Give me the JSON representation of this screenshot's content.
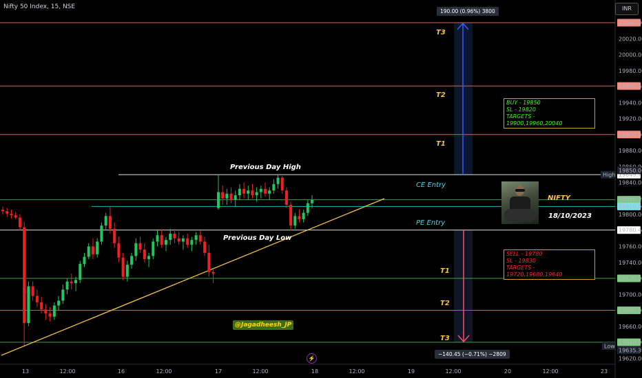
{
  "header": {
    "symbol": "Nifty 50 Index, 15, NSE",
    "currency": "INR"
  },
  "chart_data": {
    "type": "candlestick",
    "title": "Nifty 50 Index, 15, NSE",
    "ylim": [
      19620,
      20055
    ],
    "y_ticks": [
      19620,
      19640,
      19660,
      19680,
      19700,
      19720,
      19740,
      19760,
      19780,
      19800,
      19820,
      19840,
      19860,
      19880,
      19900,
      19920,
      19940,
      19960,
      19980,
      20000,
      20020,
      20040
    ],
    "x_ticks": [
      "13",
      "12:00",
      "16",
      "12:00",
      "17",
      "12:00",
      "18",
      "12:00",
      "19",
      "12:00",
      "20",
      "12:00",
      "23"
    ],
    "h_levels": [
      {
        "value": 20040.0,
        "label": "20040.00",
        "color": "#e57373",
        "bg": "#f28b82"
      },
      {
        "value": 19960.75,
        "label": "19960.75",
        "color": "#e57373",
        "bg": "#f28b82"
      },
      {
        "value": 19900.0,
        "label": "19900.00",
        "color": "#e57373",
        "bg": "#f28b82"
      },
      {
        "value": 19849.75,
        "label": "19849.75",
        "color": "#ffffff",
        "bg": "#ffffff"
      },
      {
        "value": 19818.35,
        "label": "19818.35",
        "color": "#4caf50",
        "bg": "#81c784"
      },
      {
        "value": 19810.0,
        "label": "19810.00",
        "color": "#26c6da",
        "bg": "#80deea"
      },
      {
        "value": 19780.45,
        "label": "19780.45",
        "color": "#ffffff",
        "bg": "#ffffff"
      },
      {
        "value": 19720.0,
        "label": "19720.00",
        "color": "#4caf50",
        "bg": "#81c784"
      },
      {
        "value": 19680.0,
        "label": "19680.00",
        "color": "#4caf50",
        "bg": "#81c784"
      },
      {
        "value": 19640.0,
        "label": "19640.00",
        "color": "#4caf50",
        "bg": "#81c784"
      }
    ],
    "extra_labels": [
      {
        "text": "19850.00",
        "value": 19850.0
      },
      {
        "text": "19635.30",
        "value": 19635.3
      }
    ],
    "hl_tags": {
      "high": "High",
      "low": "Low"
    },
    "annotations": {
      "prev_high": "Previous Day High",
      "prev_low": "Previous Day Low",
      "ce_entry": "CE Entry",
      "pe_entry": "PE Entry",
      "upper_targets": [
        "T3",
        "T2",
        "T1"
      ],
      "lower_targets": [
        "T1",
        "T2",
        "T3"
      ],
      "up_measure": "190.00 (0.96%) 3800",
      "down_measure": "−140.45 (−0.71%) −2809",
      "nifty": "NIFTY",
      "date": "18/10/2023",
      "watermark": "@Jagadheesh_JP"
    },
    "buy_box": [
      "BUY - 19850",
      "SL - 19820",
      "TARGETS - 19900,19960,20040"
    ],
    "sell_box": [
      "SELL - 19780",
      "SL - 19830",
      "TARGETS - 19720,19680,19640"
    ],
    "candles": [
      [
        19806,
        19810,
        19800,
        19804
      ],
      [
        19804,
        19808,
        19797,
        19801
      ],
      [
        19801,
        19806,
        19795,
        19799
      ],
      [
        19799,
        19803,
        19794,
        19796
      ],
      [
        19796,
        19800,
        19780,
        19784
      ],
      [
        19784,
        19791,
        19636,
        19664
      ],
      [
        19664,
        19716,
        19660,
        19710
      ],
      [
        19710,
        19716,
        19692,
        19698
      ],
      [
        19698,
        19706,
        19684,
        19690
      ],
      [
        19690,
        19697,
        19676,
        19681
      ],
      [
        19681,
        19688,
        19668,
        19676
      ],
      [
        19676,
        19684,
        19666,
        19672
      ],
      [
        19672,
        19690,
        19668,
        19686
      ],
      [
        19686,
        19698,
        19680,
        19692
      ],
      [
        19692,
        19712,
        19688,
        19706
      ],
      [
        19706,
        19720,
        19700,
        19716
      ],
      [
        19716,
        19726,
        19706,
        19714
      ],
      [
        19714,
        19722,
        19704,
        19718
      ],
      [
        19718,
        19742,
        19714,
        19738
      ],
      [
        19738,
        19752,
        19734,
        19747
      ],
      [
        19747,
        19764,
        19744,
        19760
      ],
      [
        19760,
        19770,
        19744,
        19750
      ],
      [
        19750,
        19770,
        19746,
        19766
      ],
      [
        19766,
        19790,
        19762,
        19786
      ],
      [
        19786,
        19802,
        19780,
        19798
      ],
      [
        19798,
        19810,
        19776,
        19782
      ],
      [
        19782,
        19790,
        19758,
        19764
      ],
      [
        19764,
        19772,
        19740,
        19746
      ],
      [
        19746,
        19752,
        19718,
        19722
      ],
      [
        19722,
        19742,
        19716,
        19737
      ],
      [
        19737,
        19752,
        19732,
        19748
      ],
      [
        19748,
        19770,
        19742,
        19764
      ],
      [
        19764,
        19772,
        19752,
        19756
      ],
      [
        19756,
        19764,
        19740,
        19744
      ],
      [
        19744,
        19752,
        19734,
        19748
      ],
      [
        19748,
        19770,
        19744,
        19766
      ],
      [
        19766,
        19780,
        19760,
        19774
      ],
      [
        19774,
        19782,
        19758,
        19762
      ],
      [
        19762,
        19772,
        19754,
        19768
      ],
      [
        19768,
        19782,
        19762,
        19776
      ],
      [
        19776,
        19782,
        19764,
        19770
      ],
      [
        19770,
        19778,
        19762,
        19766
      ],
      [
        19766,
        19774,
        19756,
        19770
      ],
      [
        19770,
        19776,
        19758,
        19762
      ],
      [
        19762,
        19772,
        19754,
        19768
      ],
      [
        19768,
        19778,
        19762,
        19774
      ],
      [
        19774,
        19780,
        19762,
        19766
      ],
      [
        19766,
        19772,
        19748,
        19752
      ],
      [
        19752,
        19762,
        19722,
        19728
      ],
      [
        19728,
        19732,
        19714,
        19726
      ],
      [
        19808,
        19850,
        19806,
        19828
      ],
      [
        19828,
        19836,
        19812,
        19820
      ],
      [
        19820,
        19832,
        19812,
        19826
      ],
      [
        19826,
        19834,
        19814,
        19818
      ],
      [
        19818,
        19830,
        19810,
        19824
      ],
      [
        19824,
        19838,
        19818,
        19832
      ],
      [
        19832,
        19840,
        19820,
        19826
      ],
      [
        19826,
        19836,
        19818,
        19830
      ],
      [
        19830,
        19838,
        19820,
        19824
      ],
      [
        19824,
        19834,
        19816,
        19828
      ],
      [
        19828,
        19836,
        19820,
        19832
      ],
      [
        19832,
        19840,
        19822,
        19826
      ],
      [
        19826,
        19834,
        19818,
        19830
      ],
      [
        19830,
        19844,
        19826,
        19838
      ],
      [
        19838,
        19850,
        19832,
        19846
      ],
      [
        19846,
        19848,
        19826,
        19830
      ],
      [
        19830,
        19834,
        19808,
        19812
      ],
      [
        19812,
        19816,
        19780,
        19786
      ],
      [
        19786,
        19802,
        19782,
        19798
      ],
      [
        19798,
        19806,
        19790,
        19794
      ],
      [
        19794,
        19806,
        19790,
        19802
      ],
      [
        19802,
        19818,
        19798,
        19814
      ],
      [
        19814,
        19824,
        19808,
        19818
      ]
    ]
  }
}
